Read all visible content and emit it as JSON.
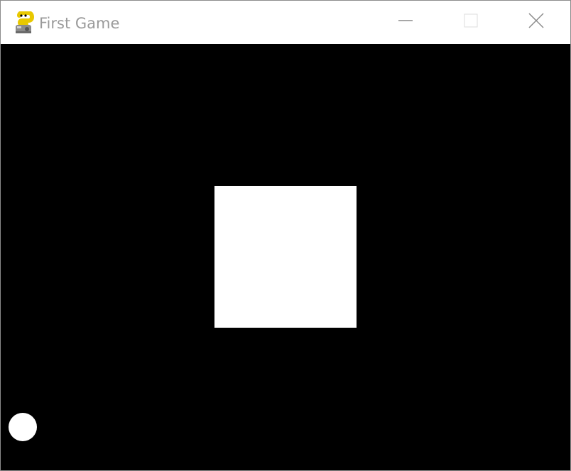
{
  "window": {
    "title": "First Game",
    "app_icon": "pygame-snake-icon",
    "controls": {
      "minimize_icon": "minimize-icon",
      "maximize_icon": "maximize-icon",
      "close_icon": "close-icon"
    }
  },
  "game": {
    "background_color": "#000000",
    "objects": [
      {
        "name": "square",
        "shape": "rectangle",
        "color": "#ffffff"
      },
      {
        "name": "ball",
        "shape": "circle",
        "color": "#ffffff"
      }
    ]
  }
}
